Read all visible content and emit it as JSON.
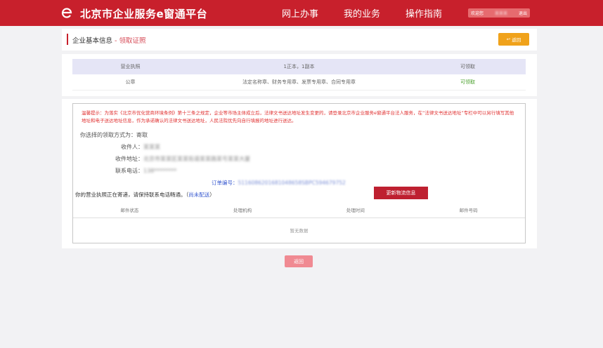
{
  "header": {
    "logo_text": "北京市企业服务e窗通平台",
    "nav": [
      "网上办事",
      "我的业务",
      "操作指南"
    ],
    "user": {
      "welcome": "欢迎您",
      "name": "某某某",
      "logout": "退出"
    }
  },
  "page": {
    "title": "企业基本信息",
    "separator": " - ",
    "subtitle": "领取证照",
    "return_top": "返回"
  },
  "license_table": {
    "columns": [
      "营业执照",
      "1正本，1副本",
      "可领取"
    ],
    "rows": [
      [
        "公章",
        "法定名称章、财务专用章、发票专用章、合同专用章",
        "可领取"
      ]
    ]
  },
  "notice": "温馨提示：为落实《北京市优化营商环境条例》第十三条之规定，企业等市场主体成立后，法律文书送达地址发生变更的，请登录北京市企业服务e窗通平台法人服务，在“法律文书送达地址”专栏中可以另行填写其他地址和电子送达地址信息，作为承诺确认的法律文书送达地址，人民法院优先向自行填报的地址进行送达。",
  "pickup": {
    "method_label": "你选择的领取方式为：",
    "method_value": "寄取",
    "recipient_label": "收件人：",
    "recipient_value": "某某某",
    "address_label": "收件地址：",
    "address_value": "北京市某某区某某街道某某路某号某某大厦",
    "phone_label": "联系电话：",
    "phone_value": "138********",
    "order_label": "订单编号：",
    "order_value": "5116086201681048658SBPC594679752",
    "delivery_text": "你的营业执照正在寄递，请保持联系电话畅通。（",
    "delivery_status": "尚未配送",
    "delivery_close": "）",
    "update_button": "更新物流信息"
  },
  "logistics_table": {
    "columns": [
      "邮件状态",
      "处理机构",
      "处理时间",
      "邮件号码"
    ],
    "empty_text": "暂无数据"
  },
  "return_bottom": "返回",
  "colors": {
    "brand_red": "#c8202c",
    "accent_orange": "#f0a21b",
    "success_green": "#4aa02c"
  }
}
